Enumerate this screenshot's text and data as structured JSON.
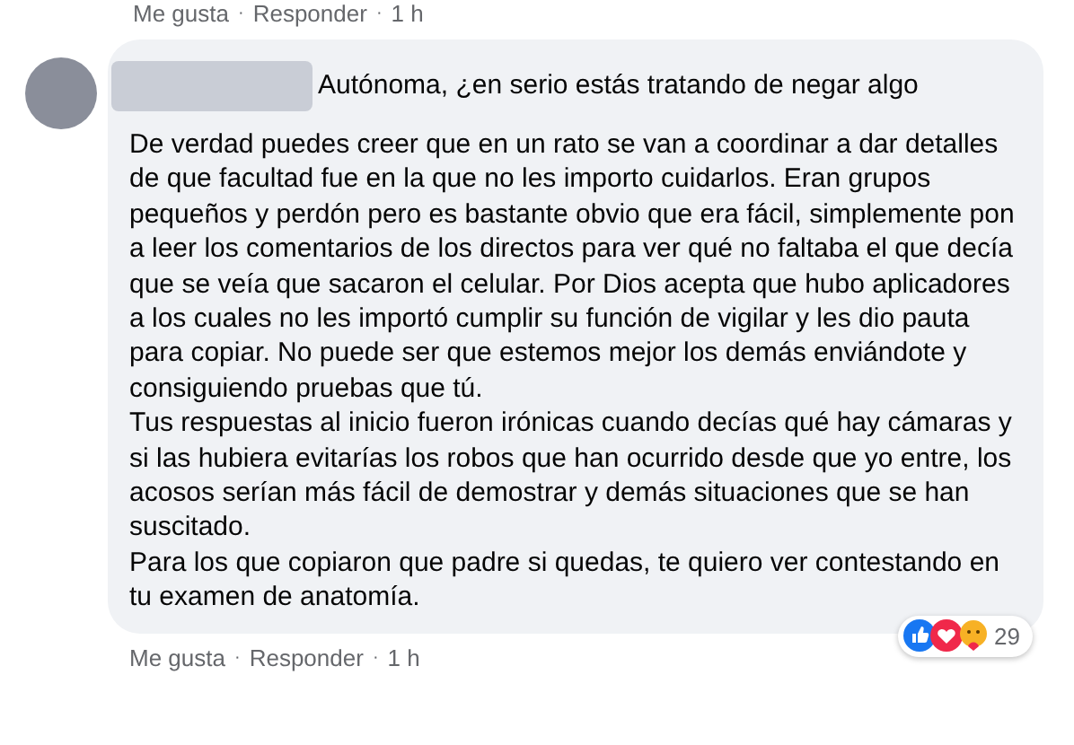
{
  "previous_comment_actions": {
    "like": "Me gusta",
    "separator_1": "·",
    "reply": "Responder",
    "separator_2": "·",
    "time": "1 h"
  },
  "comment": {
    "first_line": "Autónoma, ¿en serio estás tratando de negar algo",
    "paragraphs": [
      "De verdad puedes creer que en un rato se van a coordinar a dar detalles de que facultad fue en la que no les importo cuidarlos. Eran grupos pequeños y perdón pero es bastante obvio que era fácil, simplemente pon a leer los comentarios de los directos para ver qué no faltaba el que decía que se veía que sacaron el celular. Por Dios acepta que hubo aplicadores a los cuales no les importó cumplir su función de vigilar y les dio pauta para copiar. No puede ser que estemos mejor los demás enviándote y consiguiendo pruebas que tú.",
      "Tus respuestas al inicio fueron irónicas cuando decías qué hay cámaras y si las hubiera evitarías los robos que han ocurrido desde que yo entre, los acosos serían más fácil de demostrar y demás situaciones que se han suscitado.",
      "Para los que copiaron que padre si quedas, te quiero ver contestando en tu examen de anatomía."
    ],
    "actions": {
      "like": "Me gusta",
      "separator_1": "·",
      "reply": "Responder",
      "separator_2": "·",
      "time": "1 h"
    },
    "reactions": {
      "count": "29"
    }
  }
}
